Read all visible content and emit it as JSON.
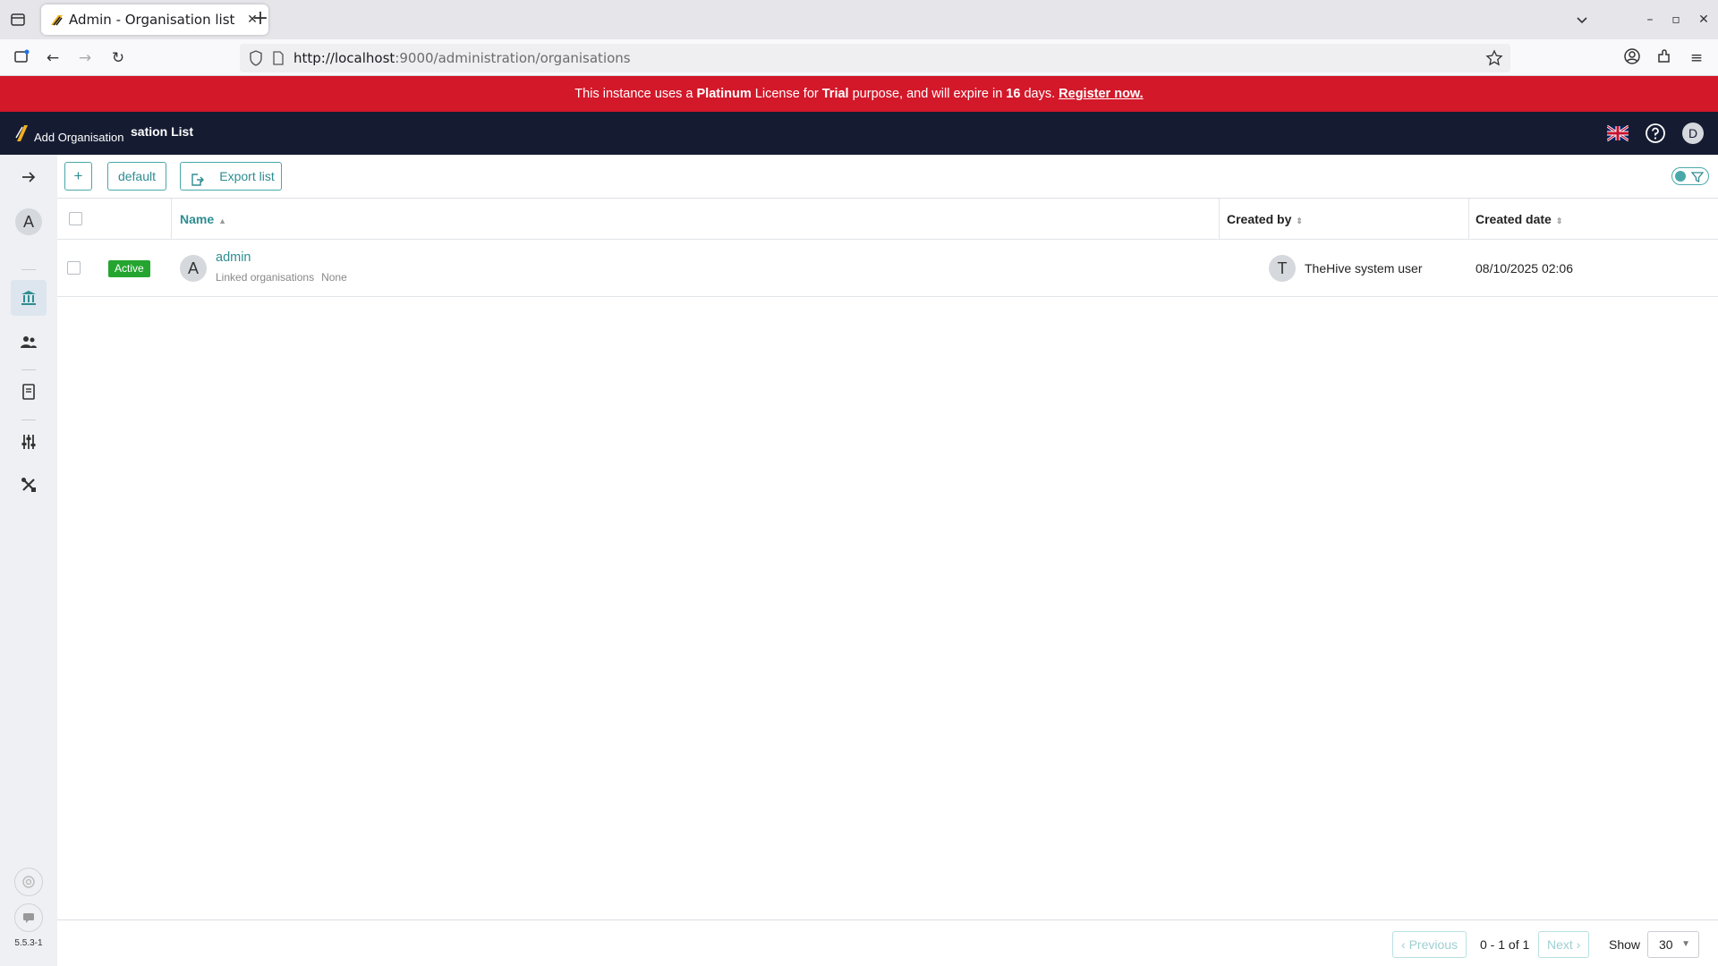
{
  "browser": {
    "tab_title": "Admin - Organisation list",
    "url_host": "http://localhost",
    "url_rest": ":9000/administration/organisations"
  },
  "license": {
    "pre": "This instance uses a ",
    "license_name": "Platinum",
    "mid1": " License for ",
    "purpose": "Trial",
    "mid2": " purpose, and will expire in ",
    "days": "16",
    "mid3": " days. ",
    "link": "Register now."
  },
  "header": {
    "title": "sation List",
    "tooltip": "Add Organisation",
    "user_initial": "D"
  },
  "sidebar": {
    "user_initial": "A",
    "version": "5.5.3-1"
  },
  "toolbar": {
    "add_label": "+",
    "default_label": "default",
    "export_label": "Export list"
  },
  "table": {
    "columns": {
      "name": "Name",
      "created_by": "Created by",
      "created_date": "Created date"
    },
    "rows": [
      {
        "status": "Active",
        "avatar": "A",
        "name": "admin",
        "linked_label": "Linked organisations",
        "linked_value": "None",
        "creator_avatar": "T",
        "created_by": "TheHive system user",
        "created_date": "08/10/2025 02:06"
      }
    ]
  },
  "pagination": {
    "previous": "Previous",
    "range": "0 - 1 of 1",
    "next": "Next",
    "show_label": "Show",
    "page_size": "30"
  },
  "colors": {
    "banner": "#d3182a",
    "header": "#151c32",
    "accent": "#2e8d91",
    "active_badge": "#25a530"
  }
}
